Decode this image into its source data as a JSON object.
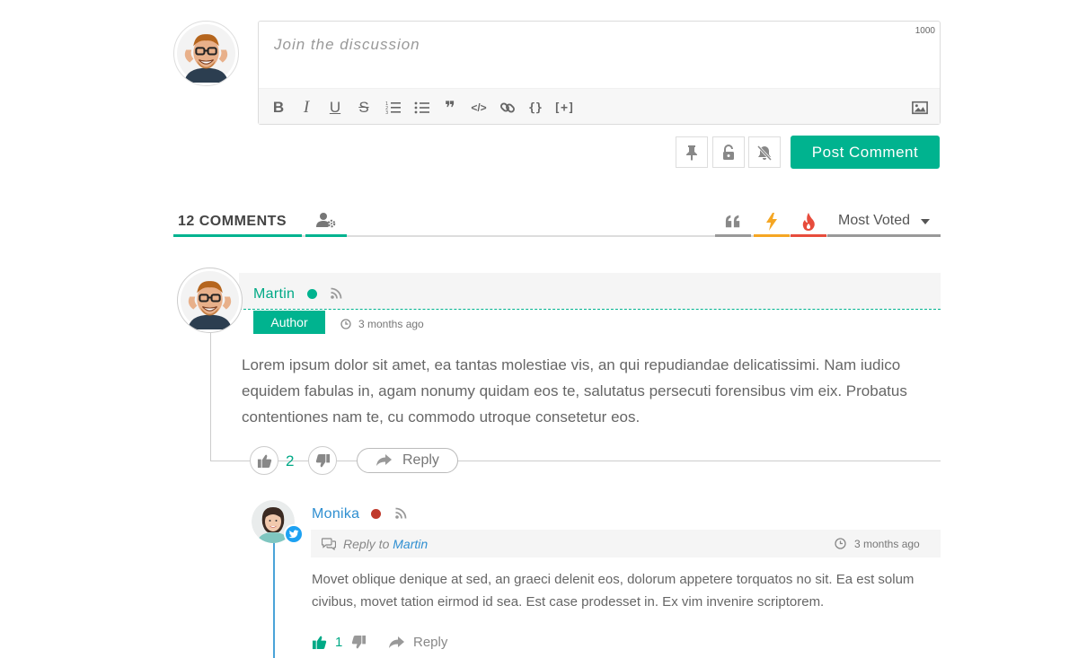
{
  "composer": {
    "placeholder": "Join the discussion",
    "char_limit": "1000",
    "toolbar": {
      "bold": "B",
      "italic": "I",
      "underline": "U",
      "strike": "S",
      "quote": "❞",
      "code": "</>",
      "source_code": "{}",
      "spoiler": "[+]"
    },
    "post_label": "Post Comment"
  },
  "comments_header": {
    "count_label": "12 COMMENTS",
    "sort_label": "Most Voted"
  },
  "comments": [
    {
      "author": "Martin",
      "status_color": "#00b38f",
      "role": "Author",
      "date": "3 months ago",
      "text": "Lorem ipsum dolor sit amet, ea tantas molestiae vis, an qui repudiandae delicatissimi. Nam iudico equidem fabulas in, agam nonumy quidam eos te, salutatus persecuti forensibus vim eix. Probatus contentiones nam te, cu commodo utroque consetetur eos.",
      "votes": "2",
      "reply_label": "Reply"
    },
    {
      "author": "Monika",
      "status_color": "#c0392b",
      "social": "twitter-icon",
      "reply_to_prefix": "Reply to",
      "reply_to_name": "Martin",
      "date": "3 months ago",
      "text": "Movet oblique denique at sed, an graeci delenit eos, dolorum appetere torquatos no sit. Ea est solum civibus, movet tation eirmod id sea. Est case prodesset in. Ex vim invenire scriptorem.",
      "votes": "1",
      "reply_label": "Reply"
    }
  ],
  "colors": {
    "accent": "#00b38f",
    "reply_blue": "#2f8fd1",
    "newest_tab": "#f5a623",
    "hot_tab": "#e74c3c"
  }
}
